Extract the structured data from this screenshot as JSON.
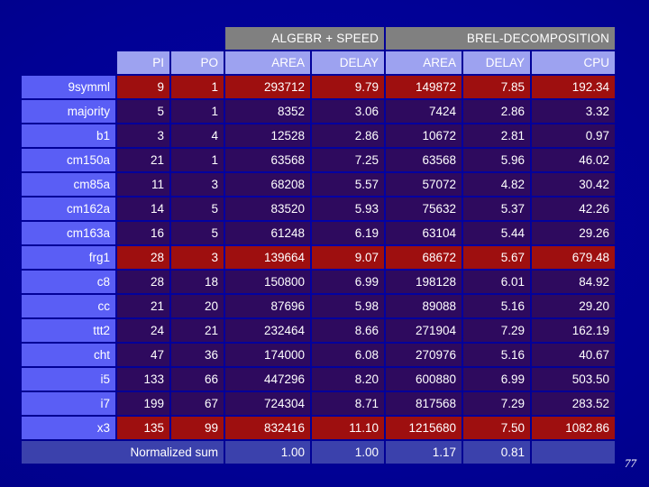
{
  "slide": {
    "page_number": "77",
    "background_color": "#00018f"
  },
  "table": {
    "group_headers": [
      {
        "label": "",
        "span": 3
      },
      {
        "label": "ALGEBR + SPEED",
        "span": 2
      },
      {
        "label": "BREL-DECOMPOSITION",
        "span": 3
      }
    ],
    "column_headers": [
      "",
      "PI",
      "PO",
      "AREA",
      "DELAY",
      "AREA",
      "DELAY",
      "CPU"
    ],
    "rows": [
      {
        "name": "9symml",
        "highlight": true,
        "values": [
          "9",
          "1",
          "293712",
          "9.79",
          "149872",
          "7.85",
          "192.34"
        ]
      },
      {
        "name": "majority",
        "highlight": false,
        "values": [
          "5",
          "1",
          "8352",
          "3.06",
          "7424",
          "2.86",
          "3.32"
        ]
      },
      {
        "name": "b1",
        "highlight": false,
        "values": [
          "3",
          "4",
          "12528",
          "2.86",
          "10672",
          "2.81",
          "0.97"
        ]
      },
      {
        "name": "cm150a",
        "highlight": false,
        "values": [
          "21",
          "1",
          "63568",
          "7.25",
          "63568",
          "5.96",
          "46.02"
        ]
      },
      {
        "name": "cm85a",
        "highlight": false,
        "values": [
          "11",
          "3",
          "68208",
          "5.57",
          "57072",
          "4.82",
          "30.42"
        ]
      },
      {
        "name": "cm162a",
        "highlight": false,
        "values": [
          "14",
          "5",
          "83520",
          "5.93",
          "75632",
          "5.37",
          "42.26"
        ]
      },
      {
        "name": "cm163a",
        "highlight": false,
        "values": [
          "16",
          "5",
          "61248",
          "6.19",
          "63104",
          "5.44",
          "29.26"
        ]
      },
      {
        "name": "frg1",
        "highlight": true,
        "values": [
          "28",
          "3",
          "139664",
          "9.07",
          "68672",
          "5.67",
          "679.48"
        ]
      },
      {
        "name": "c8",
        "highlight": false,
        "values": [
          "28",
          "18",
          "150800",
          "6.99",
          "198128",
          "6.01",
          "84.92"
        ]
      },
      {
        "name": "cc",
        "highlight": false,
        "values": [
          "21",
          "20",
          "87696",
          "5.98",
          "89088",
          "5.16",
          "29.20"
        ]
      },
      {
        "name": "ttt2",
        "highlight": false,
        "values": [
          "24",
          "21",
          "232464",
          "8.66",
          "271904",
          "7.29",
          "162.19"
        ]
      },
      {
        "name": "cht",
        "highlight": false,
        "values": [
          "47",
          "36",
          "174000",
          "6.08",
          "270976",
          "5.16",
          "40.67"
        ]
      },
      {
        "name": "i5",
        "highlight": false,
        "values": [
          "133",
          "66",
          "447296",
          "8.20",
          "600880",
          "6.99",
          "503.50"
        ]
      },
      {
        "name": "i7",
        "highlight": false,
        "values": [
          "199",
          "67",
          "724304",
          "8.71",
          "817568",
          "7.29",
          "283.52"
        ]
      },
      {
        "name": "x3",
        "highlight": true,
        "values": [
          "135",
          "99",
          "832416",
          "11.10",
          "1215680",
          "7.50",
          "1082.86"
        ]
      }
    ],
    "summary": {
      "label": "Normalized sum",
      "values": [
        "1.00",
        "1.00",
        "1.17",
        "0.81",
        ""
      ]
    },
    "colors": {
      "group_header": "#808080",
      "column_header": "#9da2f0",
      "row_label": "#5a5ef5",
      "cell": "#2e0a5e",
      "cell_highlight": "#9e0f0f",
      "summary": "#3b41ac"
    }
  }
}
